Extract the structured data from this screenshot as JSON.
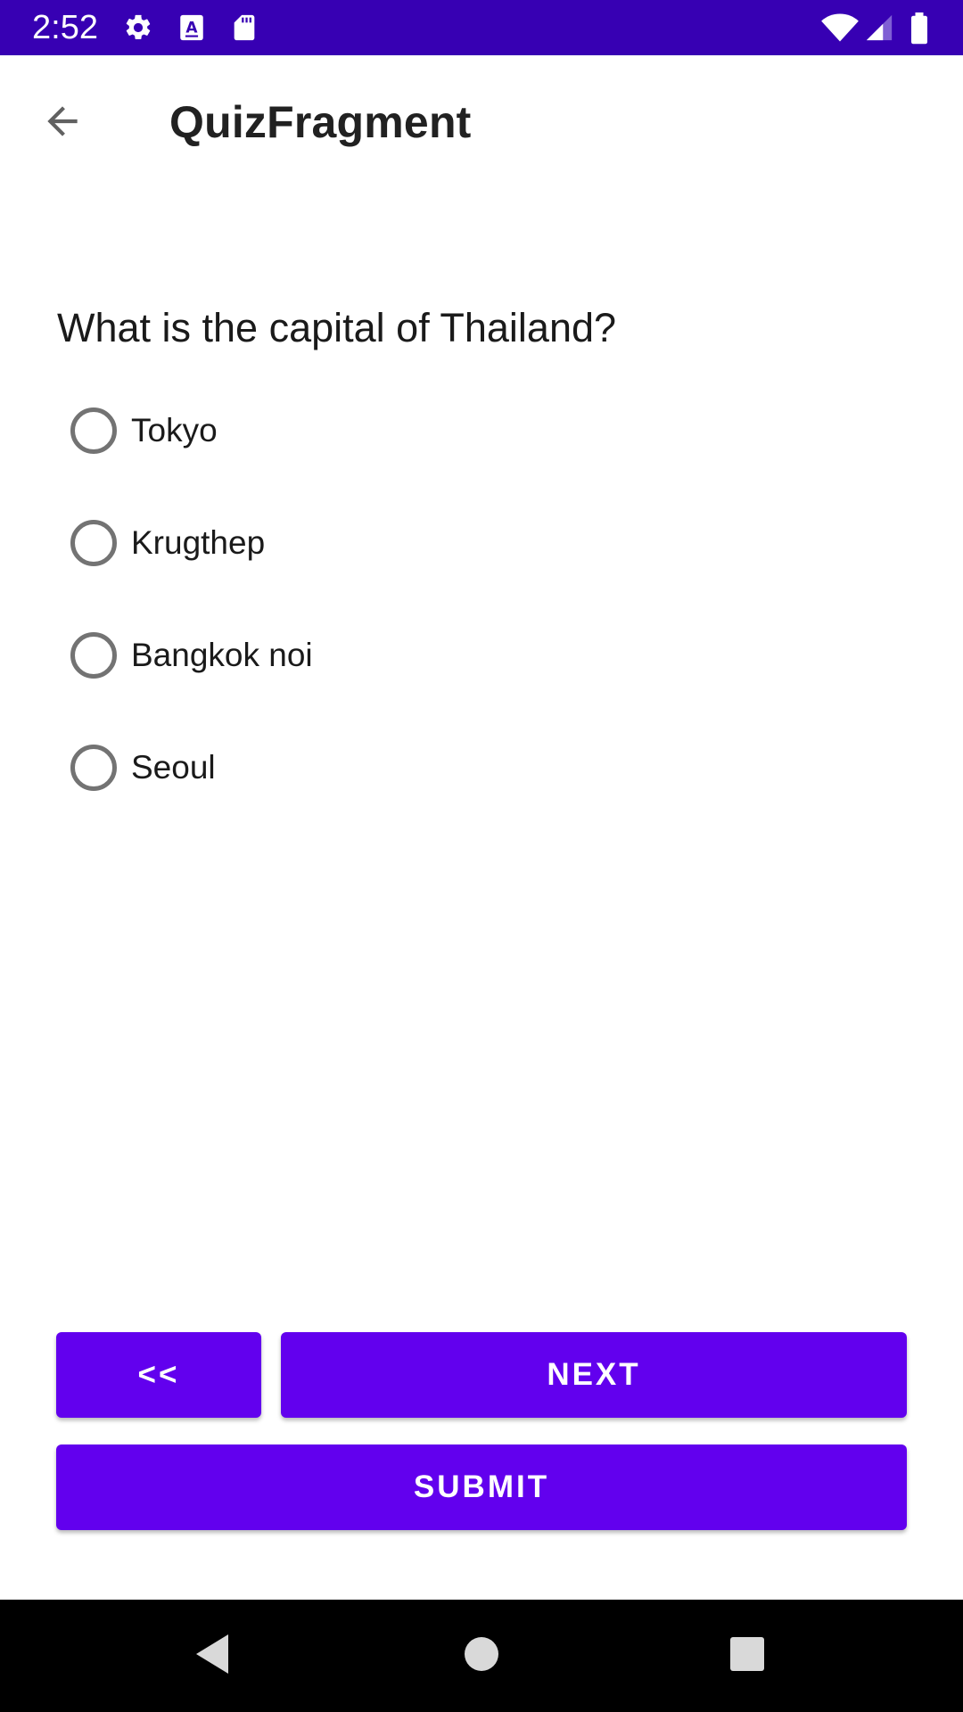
{
  "status_bar": {
    "time": "2:52",
    "background": "#3700b3",
    "icons": [
      "settings-icon",
      "text-a-icon",
      "sd-card-icon",
      "wifi-icon",
      "cell-signal-icon",
      "battery-icon"
    ]
  },
  "app_bar": {
    "title": "QuizFragment",
    "back_icon": "arrow-back-icon"
  },
  "quiz": {
    "question": "What is the capital of Thailand?",
    "options": [
      {
        "label": "Tokyo",
        "selected": false
      },
      {
        "label": "Krugthep",
        "selected": false
      },
      {
        "label": "Bangkok noi",
        "selected": false
      },
      {
        "label": "Seoul",
        "selected": false
      }
    ]
  },
  "buttons": {
    "prev_label": "<<",
    "next_label": "NEXT",
    "submit_label": "SUBMIT",
    "color": "#6200ee"
  },
  "nav_bar": {
    "icons": [
      "back-triangle-icon",
      "home-circle-icon",
      "recents-square-icon"
    ]
  }
}
